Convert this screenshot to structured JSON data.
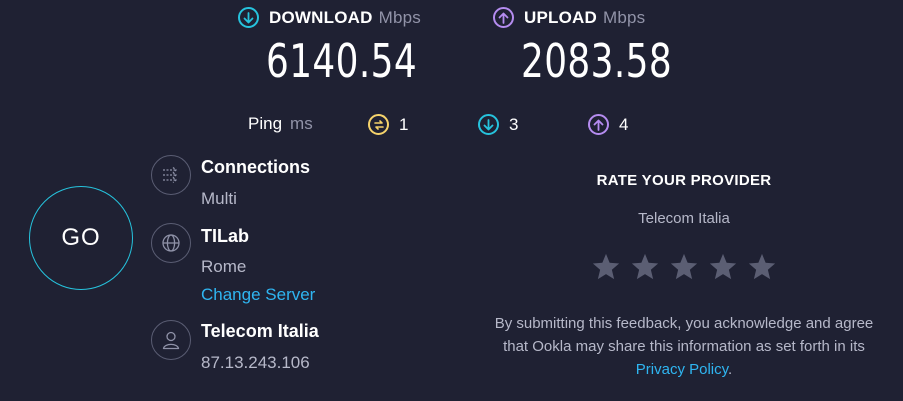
{
  "download": {
    "title": "DOWNLOAD",
    "unit": "Mbps",
    "value": "6140.54",
    "icon": "download-arrow-icon",
    "color": "#26c3dd"
  },
  "upload": {
    "title": "UPLOAD",
    "unit": "Mbps",
    "value": "2083.58",
    "icon": "upload-arrow-icon",
    "color": "#b58cf0"
  },
  "ping": {
    "label": "Ping",
    "unit": "ms",
    "idle": {
      "value": "1",
      "icon": "idle-latency-icon",
      "color": "#f5d36b"
    },
    "download": {
      "value": "3",
      "icon": "download-latency-icon",
      "color": "#26c3dd"
    },
    "upload": {
      "value": "4",
      "icon": "upload-latency-icon",
      "color": "#b58cf0"
    }
  },
  "go_button": {
    "label": "GO"
  },
  "connections": {
    "title": "Connections",
    "value": "Multi",
    "icon": "connections-icon"
  },
  "server": {
    "name": "TILab",
    "location": "Rome",
    "change_label": "Change Server",
    "icon": "globe-icon"
  },
  "isp": {
    "name": "Telecom Italia",
    "ip": "87.13.243.106",
    "icon": "user-icon"
  },
  "rate": {
    "title": "RATE YOUR PROVIDER",
    "provider": "Telecom Italia",
    "stars": 5,
    "disclaimer_text": "By submitting this feedback, you acknowledge and agree that Ookla may share this information as set forth in its",
    "privacy_link": "Privacy Policy",
    "disclaimer_end": "."
  }
}
